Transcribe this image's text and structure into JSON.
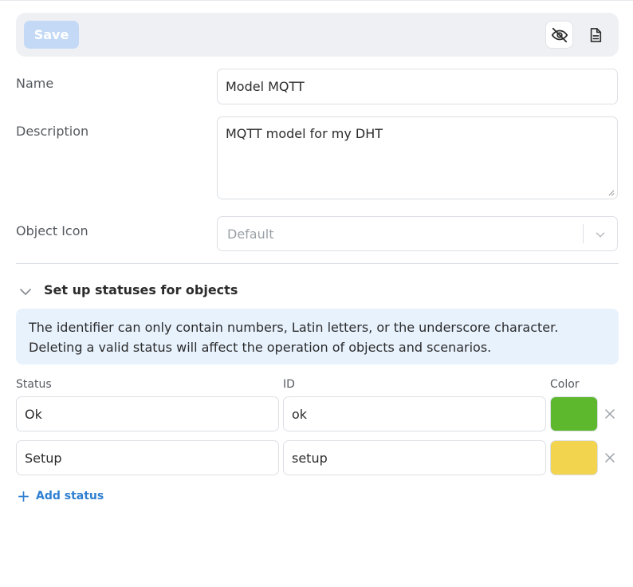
{
  "toolbar": {
    "save_label": "Save",
    "visibility_icon": "eye-off-icon",
    "document_icon": "document-icon"
  },
  "form": {
    "name_label": "Name",
    "name_value": "Model MQTT",
    "description_label": "Description",
    "description_value": "MQTT model for my DHT",
    "object_icon_label": "Object Icon",
    "object_icon_value": "Default"
  },
  "statuses_section": {
    "title": "Set up statuses for objects",
    "info_line1": "The identifier can only contain numbers, Latin letters, or the underscore character.",
    "info_line2": "Deleting a valid status will affect the operation of objects and scenarios.",
    "columns": {
      "status": "Status",
      "id": "ID",
      "color": "Color"
    },
    "rows": [
      {
        "status": "Ok",
        "id": "ok",
        "color": "#5db82e"
      },
      {
        "status": "Setup",
        "id": "setup",
        "color": "#f2d44e"
      }
    ],
    "add_label": "Add status"
  },
  "colors": {
    "accent": "#2f7fd1",
    "save_disabled": "#c4d9f5",
    "info_bg": "#e8f2fd",
    "toolbar_bg": "#eef0f3"
  }
}
